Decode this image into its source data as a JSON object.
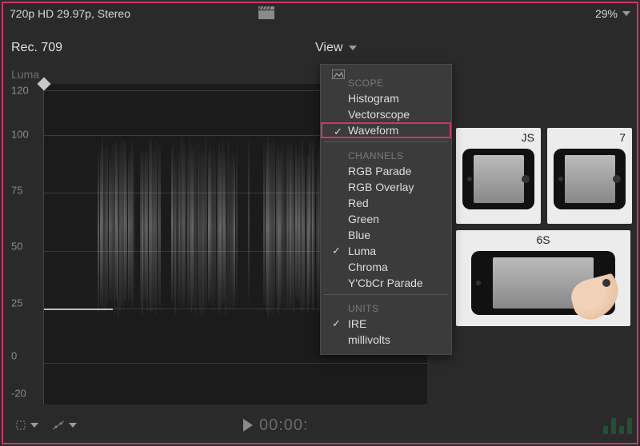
{
  "topbar": {
    "format_label": "720p HD 29.97p, Stereo",
    "zoom_label": "29%"
  },
  "secondbar": {
    "colorspace_label": "Rec. 709",
    "view_label": "View"
  },
  "waveform": {
    "title": "Luma",
    "y_ticks": [
      "120",
      "100",
      "75",
      "50",
      "25",
      "0",
      "-20"
    ]
  },
  "dropdown": {
    "sections": [
      {
        "header": "SCOPE",
        "items": [
          {
            "label": "Histogram",
            "checked": false,
            "highlight": false
          },
          {
            "label": "Vectorscope",
            "checked": false,
            "highlight": false
          },
          {
            "label": "Waveform",
            "checked": true,
            "highlight": true
          }
        ]
      },
      {
        "header": "CHANNELS",
        "items": [
          {
            "label": "RGB Parade",
            "checked": false
          },
          {
            "label": "RGB Overlay",
            "checked": false
          },
          {
            "label": "Red",
            "checked": false
          },
          {
            "label": "Green",
            "checked": false
          },
          {
            "label": "Blue",
            "checked": false
          },
          {
            "label": "Luma",
            "checked": true
          },
          {
            "label": "Chroma",
            "checked": false
          },
          {
            "label": "Y'CbCr Parade",
            "checked": false
          }
        ]
      },
      {
        "header": "UNITS",
        "items": [
          {
            "label": "IRE",
            "checked": true
          },
          {
            "label": "millivolts",
            "checked": false
          }
        ]
      }
    ]
  },
  "thumbnails": {
    "top_left_label": "JS",
    "top_right_label": "7",
    "bottom_label": "6S"
  },
  "transport": {
    "timecode": "00:00:"
  }
}
